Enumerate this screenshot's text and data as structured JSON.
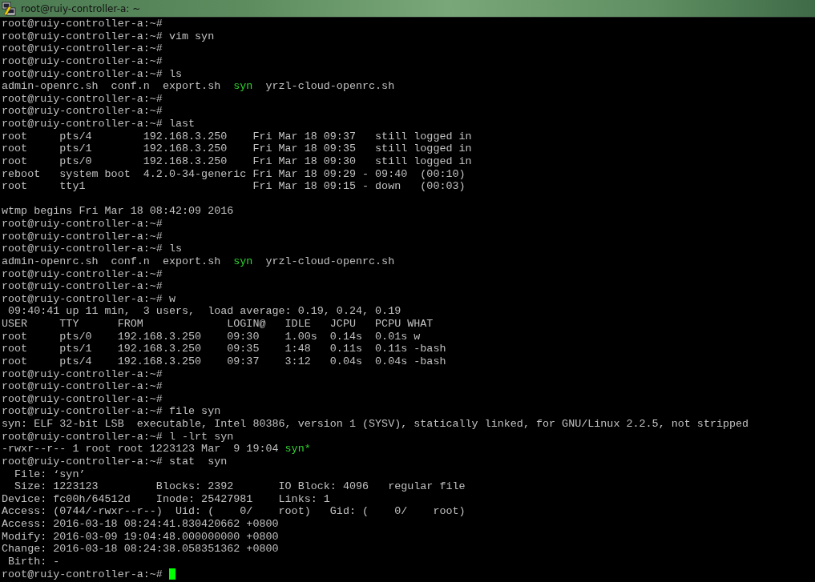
{
  "window": {
    "title": "root@ruiy-controller-a: ~"
  },
  "lines": [
    {
      "kind": "plain",
      "text": "root@ruiy-controller-a:~#"
    },
    {
      "kind": "plain",
      "text": "root@ruiy-controller-a:~# vim syn"
    },
    {
      "kind": "plain",
      "text": "root@ruiy-controller-a:~#"
    },
    {
      "kind": "plain",
      "text": "root@ruiy-controller-a:~#"
    },
    {
      "kind": "plain",
      "text": "root@ruiy-controller-a:~# ls"
    },
    {
      "kind": "colored",
      "segments": [
        {
          "text": "admin-openrc.sh  conf.n  export.sh  ",
          "color": "#c0c0c0"
        },
        {
          "text": "syn",
          "color": "#2fd42f"
        },
        {
          "text": "  yrzl-cloud-openrc.sh",
          "color": "#c0c0c0"
        }
      ]
    },
    {
      "kind": "plain",
      "text": "root@ruiy-controller-a:~#"
    },
    {
      "kind": "plain",
      "text": "root@ruiy-controller-a:~#"
    },
    {
      "kind": "plain",
      "text": "root@ruiy-controller-a:~# last"
    },
    {
      "kind": "plain",
      "text": "root     pts/4        192.168.3.250    Fri Mar 18 09:37   still logged in"
    },
    {
      "kind": "plain",
      "text": "root     pts/1        192.168.3.250    Fri Mar 18 09:35   still logged in"
    },
    {
      "kind": "plain",
      "text": "root     pts/0        192.168.3.250    Fri Mar 18 09:30   still logged in"
    },
    {
      "kind": "plain",
      "text": "reboot   system boot  4.2.0-34-generic Fri Mar 18 09:29 - 09:40  (00:10)"
    },
    {
      "kind": "plain",
      "text": "root     tty1                          Fri Mar 18 09:15 - down   (00:03)"
    },
    {
      "kind": "blank"
    },
    {
      "kind": "plain",
      "text": "wtmp begins Fri Mar 18 08:42:09 2016"
    },
    {
      "kind": "plain",
      "text": "root@ruiy-controller-a:~#"
    },
    {
      "kind": "plain",
      "text": "root@ruiy-controller-a:~#"
    },
    {
      "kind": "plain",
      "text": "root@ruiy-controller-a:~# ls"
    },
    {
      "kind": "colored",
      "segments": [
        {
          "text": "admin-openrc.sh  conf.n  export.sh  ",
          "color": "#c0c0c0"
        },
        {
          "text": "syn",
          "color": "#2fd42f"
        },
        {
          "text": "  yrzl-cloud-openrc.sh",
          "color": "#c0c0c0"
        }
      ]
    },
    {
      "kind": "plain",
      "text": "root@ruiy-controller-a:~#"
    },
    {
      "kind": "plain",
      "text": "root@ruiy-controller-a:~#"
    },
    {
      "kind": "plain",
      "text": "root@ruiy-controller-a:~# w"
    },
    {
      "kind": "plain",
      "text": " 09:40:41 up 11 min,  3 users,  load average: 0.19, 0.24, 0.19"
    },
    {
      "kind": "plain",
      "text": "USER     TTY      FROM             LOGIN@   IDLE   JCPU   PCPU WHAT"
    },
    {
      "kind": "plain",
      "text": "root     pts/0    192.168.3.250    09:30    1.00s  0.14s  0.01s w"
    },
    {
      "kind": "plain",
      "text": "root     pts/1    192.168.3.250    09:35    1:48   0.11s  0.11s -bash"
    },
    {
      "kind": "plain",
      "text": "root     pts/4    192.168.3.250    09:37    3:12   0.04s  0.04s -bash"
    },
    {
      "kind": "plain",
      "text": "root@ruiy-controller-a:~#"
    },
    {
      "kind": "plain",
      "text": "root@ruiy-controller-a:~#"
    },
    {
      "kind": "plain",
      "text": "root@ruiy-controller-a:~#"
    },
    {
      "kind": "plain",
      "text": "root@ruiy-controller-a:~# file syn"
    },
    {
      "kind": "plain",
      "text": "syn: ELF 32-bit LSB  executable, Intel 80386, version 1 (SYSV), statically linked, for GNU/Linux 2.2.5, not stripped"
    },
    {
      "kind": "plain",
      "text": "root@ruiy-controller-a:~# l -lrt syn"
    },
    {
      "kind": "colored",
      "segments": [
        {
          "text": "-rwxr--r-- 1 root root 1223123 Mar  9 19:04 ",
          "color": "#c0c0c0"
        },
        {
          "text": "syn*",
          "color": "#2fd42f"
        }
      ]
    },
    {
      "kind": "plain",
      "text": "root@ruiy-controller-a:~# stat  syn"
    },
    {
      "kind": "plain",
      "text": "  File: ‘syn’"
    },
    {
      "kind": "plain",
      "text": "  Size: 1223123         Blocks: 2392       IO Block: 4096   regular file"
    },
    {
      "kind": "plain",
      "text": "Device: fc00h/64512d    Inode: 25427981    Links: 1"
    },
    {
      "kind": "plain",
      "text": "Access: (0744/-rwxr--r--)  Uid: (    0/    root)   Gid: (    0/    root)"
    },
    {
      "kind": "plain",
      "text": "Access: 2016-03-18 08:24:41.830420662 +0800"
    },
    {
      "kind": "plain",
      "text": "Modify: 2016-03-09 19:04:48.000000000 +0800"
    },
    {
      "kind": "plain",
      "text": "Change: 2016-03-18 08:24:38.058351362 +0800"
    },
    {
      "kind": "plain",
      "text": " Birth: -"
    }
  ],
  "input_line": {
    "prompt": "root@ruiy-controller-a:~# ",
    "cursor": true
  }
}
